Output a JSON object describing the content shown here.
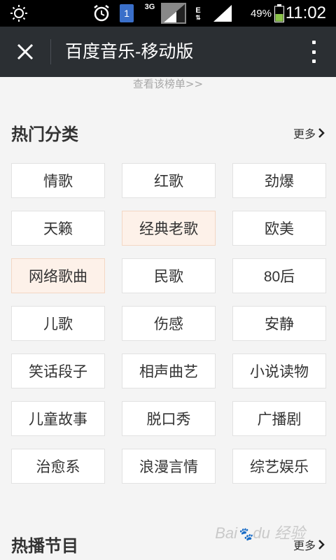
{
  "status_bar": {
    "network": "3G",
    "network_e": "E",
    "sim_badge": "1",
    "battery": "49%",
    "time": "11:02",
    "icons": [
      "brightness-icon",
      "alarm-icon",
      "sim-icon",
      "signal-icon",
      "battery-icon"
    ]
  },
  "title_bar": {
    "title": "百度音乐-移动版",
    "close_icon": "close-icon",
    "menu_icon": "overflow-menu-icon"
  },
  "view_chart_link": "查看该榜单>>",
  "hot_categories": {
    "title": "热门分类",
    "more": "更多",
    "items": [
      {
        "label": "情歌",
        "highlight": false
      },
      {
        "label": "红歌",
        "highlight": false
      },
      {
        "label": "劲爆",
        "highlight": false
      },
      {
        "label": "天籁",
        "highlight": false
      },
      {
        "label": "经典老歌",
        "highlight": true
      },
      {
        "label": "欧美",
        "highlight": false
      },
      {
        "label": "网络歌曲",
        "highlight": true
      },
      {
        "label": "民歌",
        "highlight": false
      },
      {
        "label": "80后",
        "highlight": false
      },
      {
        "label": "儿歌",
        "highlight": false
      },
      {
        "label": "伤感",
        "highlight": false
      },
      {
        "label": "安静",
        "highlight": false
      },
      {
        "label": "笑话段子",
        "highlight": false
      },
      {
        "label": "相声曲艺",
        "highlight": false
      },
      {
        "label": "小说读物",
        "highlight": false
      },
      {
        "label": "儿童故事",
        "highlight": false
      },
      {
        "label": "脱口秀",
        "highlight": false
      },
      {
        "label": "广播剧",
        "highlight": false
      },
      {
        "label": "治愈系",
        "highlight": false
      },
      {
        "label": "浪漫言情",
        "highlight": false
      },
      {
        "label": "综艺娱乐",
        "highlight": false
      }
    ]
  },
  "hot_programs": {
    "title": "热播节目",
    "more": "更多"
  },
  "watermark": "Baidu 经验",
  "colors": {
    "titlebar": "#2b2f33",
    "highlight_bg": "#fdf1e9",
    "background": "#f4f4f4"
  }
}
